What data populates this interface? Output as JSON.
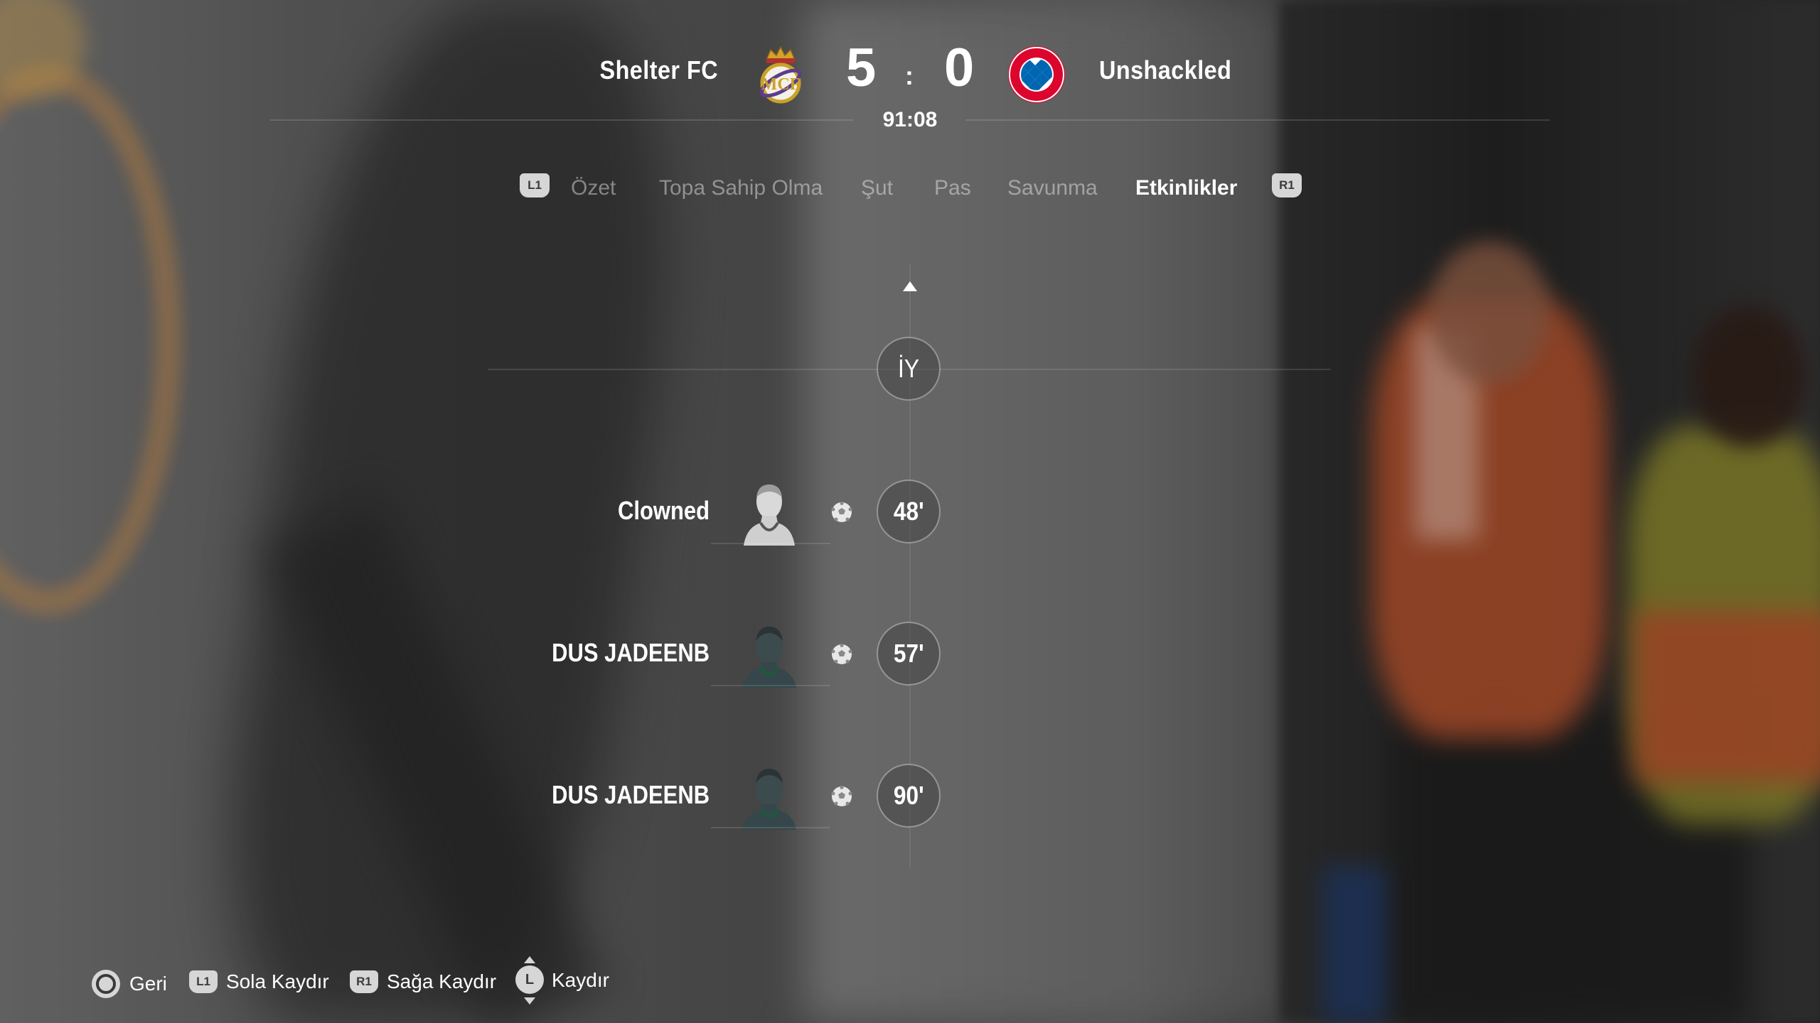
{
  "header": {
    "home_team": "Shelter FC",
    "away_team": "Unshackled",
    "home_score": "5",
    "away_score": "0",
    "separator": ":",
    "clock": "91:08",
    "home_crest_icon": "real-madrid-crest-icon",
    "away_crest_icon": "bayern-munchen-crest-icon"
  },
  "tabs": {
    "prev_bumper": "L1",
    "next_bumper": "R1",
    "items": [
      {
        "label": "Özet",
        "active": false
      },
      {
        "label": "Topa Sahip Olma",
        "active": false
      },
      {
        "label": "Şut",
        "active": false
      },
      {
        "label": "Pas",
        "active": false
      },
      {
        "label": "Savunma",
        "active": false
      },
      {
        "label": "Etkinlikler",
        "active": true
      }
    ]
  },
  "timeline": {
    "half_marker": "İY",
    "events": [
      {
        "player": "Clowned",
        "type": "goal",
        "minute": "48'"
      },
      {
        "player": "DUS JADEENB",
        "type": "goal",
        "minute": "57'"
      },
      {
        "player": "DUS JADEENB",
        "type": "goal",
        "minute": "90'"
      }
    ]
  },
  "footer": {
    "back": {
      "button": "circle-button-icon",
      "label": "Geri"
    },
    "scroll_left": {
      "button": "L1",
      "label": "Sola Kaydır"
    },
    "scroll_right": {
      "button": "R1",
      "label": "Sağa Kaydır"
    },
    "scroll": {
      "button": "L",
      "label": "Kaydır"
    }
  },
  "colors": {
    "text_primary": "#ffffff",
    "text_inactive": "#9a9a9a",
    "home_crest_gold": "#c9a227",
    "away_crest_red": "#dc052d",
    "away_crest_blue": "#0066b2"
  }
}
